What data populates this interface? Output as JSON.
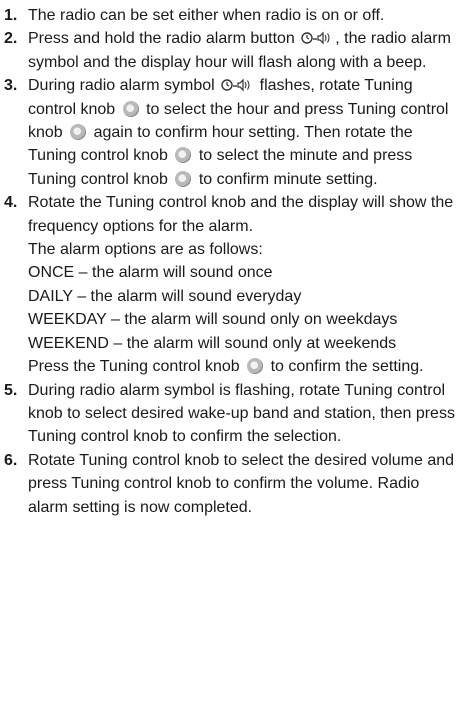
{
  "steps": [
    {
      "number": "1.",
      "lines": [
        "The radio can be set either when radio is on or off."
      ]
    },
    {
      "number": "2.",
      "text_a": "Press and hold the radio alarm button",
      "icon": "radio-alarm-icon",
      "text_b": ", the radio alarm symbol and the display hour will flash along with a beep."
    },
    {
      "number": "3.",
      "p1": "During radio alarm symbol",
      "p2": "flashes, rotate Tuning control knob",
      "p3": "to select the hour and press Tuning control knob",
      "p4": "again to confirm hour setting. Then rotate the Tuning control knob",
      "p5": "to select the minute and press Tuning control knob",
      "p6": "to confirm minute setting."
    },
    {
      "number": "4.",
      "l1": "Rotate the Tuning control knob and the display will show the frequency options for the alarm.",
      "l2": "The alarm options are as follows:",
      "l3": "ONCE – the alarm will sound once",
      "l4": "DAILY – the alarm will sound everyday",
      "l5": "WEEKDAY – the alarm will sound only on weekdays",
      "l6": "WEEKEND – the alarm will sound only at weekends",
      "l7a": "Press the Tuning control knob",
      "l7b": "to confirm the setting."
    },
    {
      "number": "5.",
      "text": "During radio alarm symbol is flashing, rotate Tuning control knob to select desired wake-up band and station, then press Tuning control knob to confirm the selection."
    },
    {
      "number": "6.",
      "text": "Rotate Tuning control knob to select the desired volume and press Tuning control knob to confirm the volume. Radio alarm setting is now completed."
    }
  ],
  "icons": {
    "knob": "tuning-knob-icon",
    "alarm": "radio-alarm-icon"
  }
}
